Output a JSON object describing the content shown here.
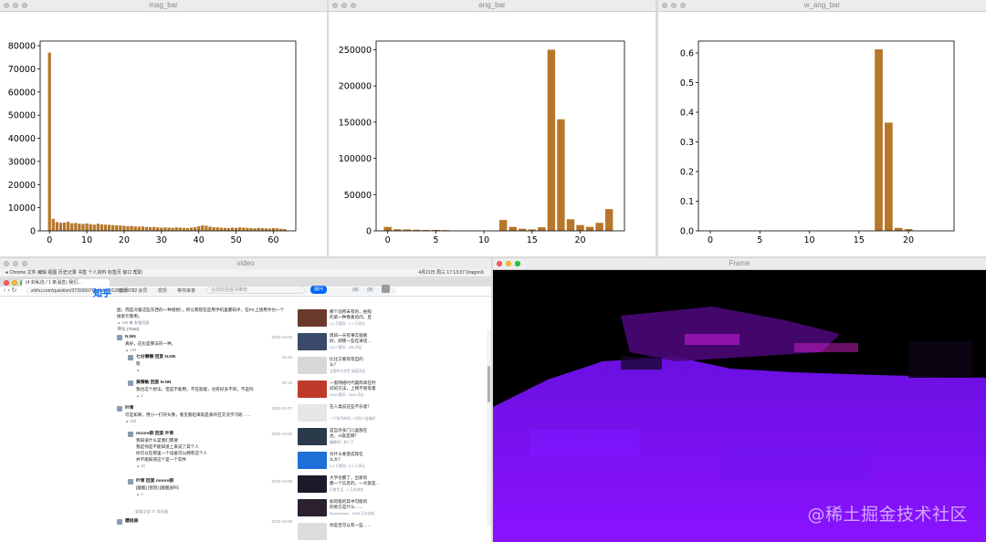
{
  "colors": {
    "bar": "#b7772a",
    "frame_bg": "#000000",
    "frame_purple": "#7a0cff",
    "zhihu_blue": "#0066ff"
  },
  "windows": {
    "mag": {
      "title": "mag_bar"
    },
    "ang": {
      "title": "ang_bar"
    },
    "wang": {
      "title": "w_ang_bar"
    },
    "video": {
      "title": "video"
    },
    "frame": {
      "title": "Frame"
    }
  },
  "chart_data": [
    {
      "type": "bar",
      "title": "",
      "xlabel": "",
      "ylabel": "",
      "xlim": [
        -2.5,
        66
      ],
      "ylim": [
        0,
        82000
      ],
      "xticks": [
        0,
        10,
        20,
        30,
        40,
        50,
        60
      ],
      "yticks": [
        0,
        10000,
        20000,
        30000,
        40000,
        50000,
        60000,
        70000,
        80000
      ],
      "ytick_labels": [
        "0",
        "10000",
        "20000",
        "30000",
        "40000",
        "50000",
        "60000",
        "70000",
        "80000"
      ],
      "x": [
        0,
        1,
        2,
        3,
        4,
        5,
        6,
        7,
        8,
        9,
        10,
        11,
        12,
        13,
        14,
        15,
        16,
        17,
        18,
        19,
        20,
        21,
        22,
        23,
        24,
        25,
        26,
        27,
        28,
        29,
        30,
        31,
        32,
        33,
        34,
        35,
        36,
        37,
        38,
        39,
        40,
        41,
        42,
        43,
        44,
        45,
        46,
        47,
        48,
        49,
        50,
        51,
        52,
        53,
        54,
        55,
        56,
        57,
        58,
        59,
        60,
        61,
        62,
        63
      ],
      "values": [
        77000,
        5200,
        3800,
        3500,
        3600,
        3900,
        3300,
        3400,
        3100,
        3000,
        3200,
        2900,
        2700,
        3100,
        2800,
        2700,
        2600,
        2500,
        2400,
        2300,
        2200,
        2000,
        2100,
        1900,
        1800,
        1900,
        1700,
        1600,
        1700,
        1500,
        1400,
        1500,
        1400,
        1300,
        1500,
        1400,
        1300,
        1200,
        1400,
        1600,
        2000,
        2400,
        2200,
        1800,
        1600,
        1500,
        1400,
        1300,
        1200,
        1400,
        1300,
        1500,
        1400,
        1300,
        1200,
        1100,
        1300,
        1200,
        1100,
        1000,
        1200,
        1100,
        900,
        800
      ]
    },
    {
      "type": "bar",
      "title": "",
      "xlabel": "",
      "ylabel": "",
      "xlim": [
        -1.2,
        24.6
      ],
      "ylim": [
        0,
        262000
      ],
      "xticks": [
        0,
        5,
        10,
        15,
        20
      ],
      "yticks": [
        0,
        50000,
        100000,
        150000,
        200000,
        250000
      ],
      "ytick_labels": [
        "0",
        "50000",
        "100000",
        "150000",
        "200000",
        "250000"
      ],
      "x": [
        0,
        1,
        2,
        3,
        4,
        5,
        6,
        7,
        8,
        9,
        10,
        11,
        12,
        13,
        14,
        15,
        16,
        17,
        18,
        19,
        20,
        21,
        22,
        23
      ],
      "values": [
        5500,
        2200,
        2000,
        1500,
        1200,
        1300,
        1000,
        0,
        0,
        0,
        0,
        0,
        15000,
        5500,
        3000,
        2000,
        5000,
        250000,
        154000,
        16000,
        8000,
        5500,
        11000,
        30000
      ]
    },
    {
      "type": "bar",
      "title": "",
      "xlabel": "",
      "ylabel": "",
      "xlim": [
        -1.2,
        24.6
      ],
      "ylim": [
        0,
        0.64
      ],
      "xticks": [
        0,
        5,
        10,
        15,
        20
      ],
      "yticks": [
        0.0,
        0.1,
        0.2,
        0.3,
        0.4,
        0.5,
        0.6
      ],
      "ytick_labels": [
        "0.0",
        "0.1",
        "0.2",
        "0.3",
        "0.4",
        "0.5",
        "0.6"
      ],
      "x": [
        0,
        1,
        2,
        3,
        4,
        5,
        6,
        7,
        8,
        9,
        10,
        11,
        12,
        13,
        14,
        15,
        16,
        17,
        18,
        19,
        20,
        21,
        22,
        23
      ],
      "values": [
        0,
        0,
        0,
        0,
        0,
        0,
        0,
        0,
        0,
        0,
        0,
        0,
        0,
        0,
        0,
        0,
        0,
        0.612,
        0.365,
        0.01,
        0.006,
        0,
        0,
        0
      ]
    }
  ],
  "video": {
    "menubar": "Chrome  文件  编辑  视图  历史记录  书签  个人资料  标签页  窗口  帮助",
    "menubar_right": "4月21日 周三 17:13:37  DragonX",
    "tab_label": "(4 封私信 / 1 条消息) 我们…",
    "url": "zhihu.com/question/373936976/answer/1289999782",
    "logo": "知乎",
    "nav_links": "首页  会员  发现  等你来答",
    "search_placeholder": "在线观看图书推荐",
    "ask_button": "提问",
    "comments": [
      {
        "name": "",
        "time": "",
        "body": "图，而是对着这些东西的一种感想），所以我现在是用手机里都知乎，在PC上想用手也一个\n搜索引擎用。",
        "meta": "▲ 166  ◉ 查看回复"
      },
      {
        "name": "评论 (Total)",
        "time": "",
        "body": "",
        "meta": ""
      },
      {
        "name": "N.NN",
        "time": "2020-10-09",
        "body": "真好，这也是算法的一种。",
        "meta": "▲ 156"
      },
      {
        "name": "七分懒懒  回复  N.NN",
        "time": "04-19",
        "body": "嗯",
        "meta": "▲"
      },
      {
        "name": "黄臻敏  回复  N.NN",
        "time": "04-19",
        "body": "我也这个想法，但是不能用，不在就能，也有好多不同，不是吗",
        "meta": "▲ 2"
      },
      {
        "name": "叶青",
        "time": "2020-10-07",
        "body": "可是如果，用小一打开头像，看见看起来就是真的在交流学习呢……",
        "meta": "▲ 333"
      },
      {
        "name": "moore群  回复  叶青",
        "time": "2020-10-08",
        "body": "我知道什么是我们需要\n我是你是不能知道上来说了其个人\n你可以在那里一个设备可以拥有这个人\n并不能知道这个是一个软件",
        "meta": "▲ 40"
      },
      {
        "name": "叶青  回复  moore群",
        "time": "2020-10-08",
        "body": "[酸酸] [愤怒] [酸酸]好吗",
        "meta": "▲ 3"
      },
      {
        "name": "",
        "time": "",
        "body": "",
        "meta": "查看全部 27 条回复"
      },
      {
        "name": "樱桃果",
        "time": "2020-10-08",
        "body": "",
        "meta": ""
      }
    ],
    "side": [
      {
        "title": "那个前所未有的，拍照\n的第一种像素的问，且",
        "meta": "1.2 万赞同 · 2.1 万评论"
      },
      {
        "title": "周四一天有事实据看\n好，即使一些在讲话…",
        "meta": "3247 赞同 · 256 评论"
      },
      {
        "title": "比比方看等等自的\n么？",
        "meta": "全国中小学生\n阅读活动"
      },
      {
        "title": "一套网络时代最简单在时\n间的方法，上网不到等量",
        "meta": "2056 赞同 · 1840 评论"
      },
      {
        "title": "在人类说这些不乐意？",
        "meta": "一个知乎的吗\n一打的人会做好"
      },
      {
        "title": "是自许多门儿里放在\n也，AI就是啊？",
        "meta": "编辑吗？多少了"
      },
      {
        "title": "为什么要变成现在\n么大？",
        "meta": "2.3 万赞同 · 6.2 万评论"
      },
      {
        "title": "大学也都了，出新的\n那一个信息的，一大就是…",
        "meta": "日常生活 · 1 万次浏览"
      },
      {
        "title": "如何能的其中可能的\n的地方是什么……",
        "meta": "Bluebonnets · 2245 万次浏览"
      },
      {
        "title": "你是否可以有一些……",
        "meta": ""
      }
    ]
  },
  "watermark": "@稀土掘金技术社区"
}
